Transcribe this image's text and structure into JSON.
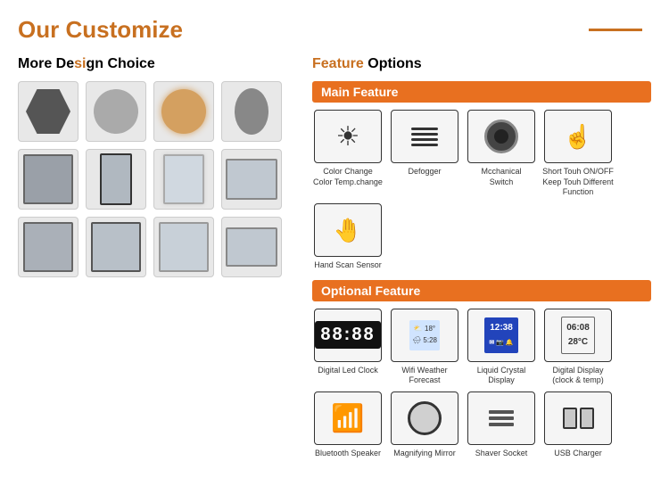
{
  "header": {
    "title_plain": "Our ",
    "title_highlight": "Customize",
    "line": true
  },
  "left": {
    "section_title_plain": "More De",
    "section_title_highlight": "si",
    "section_title_rest": "gn Choice",
    "row1": [
      "Hexagon Mirror",
      "Round Mirror",
      "Round Lit Mirror",
      "Oval Mirror"
    ],
    "row2": [
      "Rect Mirror 1",
      "Tall Mirror",
      "Lit Mirror",
      "Wide Mirror"
    ],
    "row3": [
      "Rect Mirror 2",
      "Mirror Panel",
      "Modern Mirror",
      "Landscape Mirror"
    ]
  },
  "right": {
    "section_title_plain": "",
    "section_title_highlight": "Feature",
    "section_title_rest": " Options",
    "main_feature": {
      "header": "Main Feature",
      "items": [
        {
          "label": "Color Change\nColor Temp.change",
          "icon": "sun"
        },
        {
          "label": "Defogger",
          "icon": "defog"
        },
        {
          "label": "Mcchanical\nSwitch",
          "icon": "switch"
        },
        {
          "label": "Short Touh ON/OFF\nKeep Touh Different\nFunction",
          "icon": "touch"
        },
        {
          "label": "Hand Scan Sensor",
          "icon": "hand"
        }
      ]
    },
    "optional_feature": {
      "header": "Optional Feature",
      "items": [
        {
          "label": "Digital Led Clock",
          "icon": "led-clock",
          "value": "88:88"
        },
        {
          "label": "Wifi Weather Forecast",
          "icon": "weather",
          "value": "☁ 5:28"
        },
        {
          "label": "Liquid Crystal Display",
          "icon": "lcd",
          "value": "12:38"
        },
        {
          "label": "Digital Display\n(clock & temp)",
          "icon": "digital",
          "value": "06:08\n28°C"
        },
        {
          "label": "Bluetooth Speaker",
          "icon": "bluetooth"
        },
        {
          "label": "Magnifying Mirror",
          "icon": "magnify"
        },
        {
          "label": "Shaver Socket",
          "icon": "shaver"
        },
        {
          "label": "USB Charger",
          "icon": "usb"
        }
      ]
    }
  }
}
